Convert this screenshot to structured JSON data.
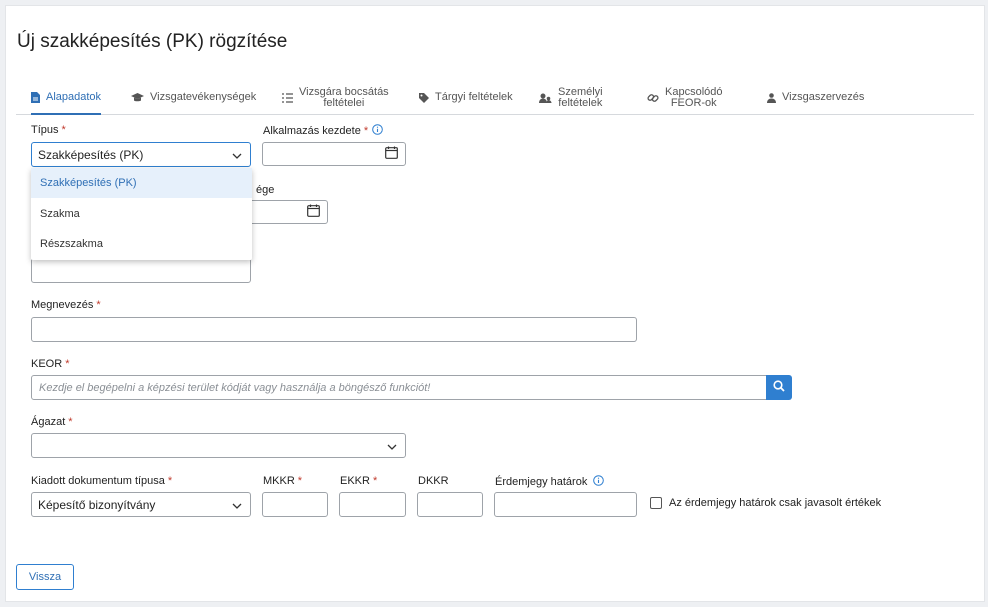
{
  "page_title": "Új szakképesítés (PK) rögzítése",
  "tabs": [
    {
      "label": "Alapadatok",
      "icon": "file-icon",
      "active": true
    },
    {
      "label": "Vizsgatevékenységek",
      "icon": "graduation-cap-icon"
    },
    {
      "label_line1": "Vizsgára bocsátás",
      "label_line2": "feltételei",
      "icon": "list-ordered-icon"
    },
    {
      "label": "Tárgyi feltételek",
      "icon": "tag-icon"
    },
    {
      "label_line1": "Személyi",
      "label_line2": "feltételek",
      "icon": "users-icon"
    },
    {
      "label_line1": "Kapcsolódó",
      "label_line2": "FEOR-ok",
      "icon": "link-icon"
    },
    {
      "label": "Vizsgaszervezés",
      "icon": "person-icon"
    }
  ],
  "form": {
    "tipus": {
      "label": "Típus",
      "required": "*",
      "value": "Szakképesítés (PK)"
    },
    "alkalmazas_kezdete": {
      "label": "Alkalmazás kezdete",
      "required": "*"
    },
    "hidden_label_fragment": "ége",
    "dropdown_options": [
      "Szakképesítés (PK)",
      "Szakma",
      "Részszakma"
    ],
    "megnevezes": {
      "label": "Megnevezés",
      "required": "*"
    },
    "keor": {
      "label": "KEOR",
      "required": "*",
      "placeholder": "Kezdje el begépelni a képzési terület kódját vagy használja a böngésző funkciót!"
    },
    "agazat": {
      "label": "Ágazat",
      "required": "*"
    },
    "kiadott_dok": {
      "label": "Kiadott dokumentum típusa",
      "required": "*",
      "value": "Képesítő bizonyítvány"
    },
    "mkkr": {
      "label": "MKKR",
      "required": "*"
    },
    "ekkr": {
      "label": "EKKR",
      "required": "*"
    },
    "dkkr": {
      "label": "DKKR"
    },
    "erdemjegy": {
      "label": "Érdemjegy határok"
    },
    "checkbox_label": "Az érdemjegy határok csak javasolt értékek"
  },
  "buttons": {
    "back": "Vissza"
  },
  "colors": {
    "accent": "#2f6fb5",
    "required": "#c0392b",
    "button_blue": "#2f7fd0"
  }
}
